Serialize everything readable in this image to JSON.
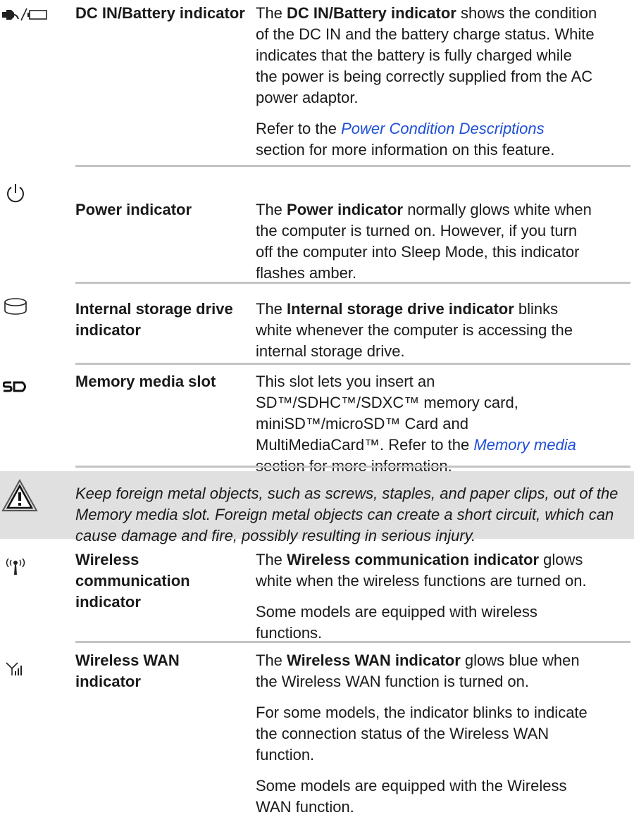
{
  "rows": [
    {
      "icon": "dc-in-battery-icon",
      "term": "DC IN/Battery indicator",
      "p1": {
        "a": "The ",
        "b": "DC IN/Battery indicator",
        "c": " shows the condition of the DC IN and the battery charge status. White indicates that the battery is fully charged while the power is being correctly supplied from the AC power adaptor."
      },
      "p2": {
        "a": "Refer to the ",
        "link": "Power Condition Descriptions",
        "c": " section for more information on this feature."
      }
    },
    {
      "icon": "power-icon",
      "term": "Power indicator",
      "p1": {
        "a": "The ",
        "b": "Power indicator",
        "c": " normally glows white when the computer is turned on. However, if you turn off the computer into Sleep Mode, this indicator flashes amber."
      }
    },
    {
      "icon": "storage-drive-icon",
      "term": "Internal storage drive indicator",
      "p1": {
        "a": "The ",
        "b": "Internal storage drive indicator",
        "c": " blinks white whenever the computer is accessing the internal storage drive."
      }
    },
    {
      "icon": "sd-card-icon",
      "term": "Memory media slot",
      "p1": {
        "a": "This slot lets you insert an SD™/SDHC™/SDXC™ memory card, miniSD™/microSD™ Card and MultiMediaCard™. Refer to the ",
        "link": "Memory media",
        "c": " section for more information."
      }
    },
    {
      "icon": "wireless-communication-icon",
      "term": "Wireless communication indicator",
      "p1": {
        "a": "The ",
        "b": "Wireless communication indicator",
        "c": " glows white when the wireless functions are turned on."
      },
      "p2": {
        "a": "Some models are equipped with wireless functions."
      }
    },
    {
      "icon": "wireless-wan-icon",
      "term": "Wireless WAN indicator",
      "p1": {
        "a": "The ",
        "b": "Wireless WAN indicator",
        "c": " glows blue when the Wireless WAN function is turned on."
      },
      "p2": {
        "a": "For some models, the indicator blinks to indicate the connection status of the Wireless WAN function."
      },
      "p3": {
        "a": "Some models are equipped with the Wireless WAN function."
      }
    }
  ],
  "warning": {
    "icon": "warning-icon",
    "text": "Keep foreign metal objects, such as screws, staples, and paper clips, out of the Memory media slot. Foreign metal objects can create a short circuit, which can cause damage and fire, possibly resulting in serious injury."
  },
  "colors": {
    "link": "#1f4fd6",
    "divider": "#c4c4c4",
    "warning_bg": "#e0e0e0"
  }
}
